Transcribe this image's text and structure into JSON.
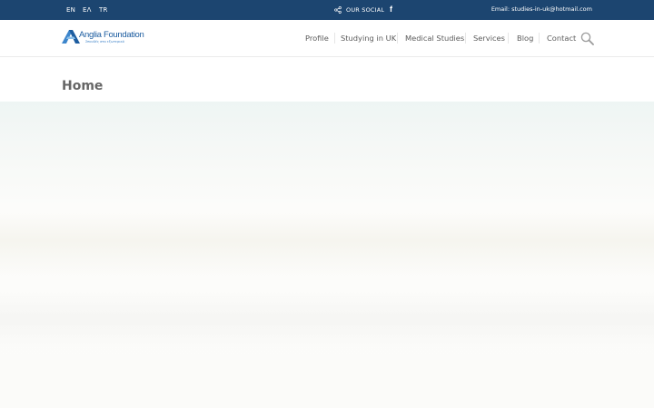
{
  "topbar": {
    "languages": [
      "EN",
      "ΕΛ",
      "TR"
    ],
    "social_label": "OUR SOCIAL",
    "facebook_glyph": "f",
    "email": "Email: studies-in-uk@hotmail.com",
    "background": "#1c4570"
  },
  "header": {
    "logo_text": "Anglia Foundation",
    "logo_tagline": "Σπουδές στο εξωτερικό",
    "nav": [
      "Profile",
      "Studying in UK",
      "Medical Studies",
      "Services",
      "Blog",
      "Contact"
    ],
    "search_icon": "search-icon"
  },
  "page": {
    "title": "Home"
  },
  "colors": {
    "accent": "#1d5da0",
    "topbar": "#1c4570"
  }
}
